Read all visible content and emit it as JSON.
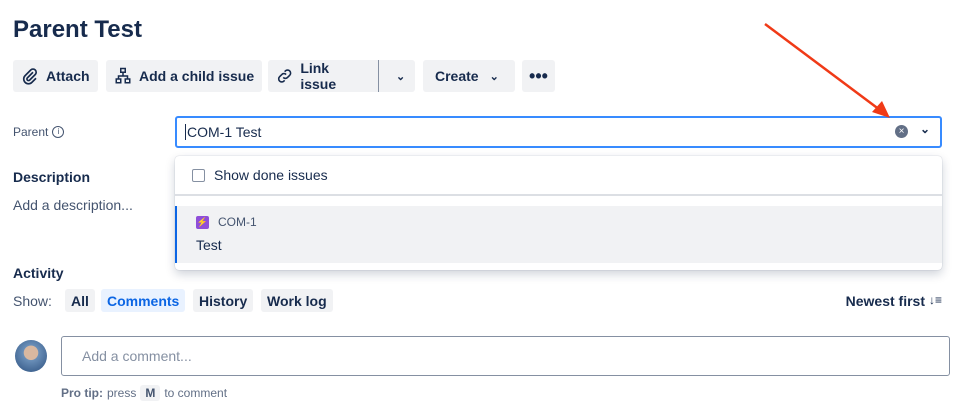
{
  "title": "Parent Test",
  "toolbar": {
    "attach": "Attach",
    "add_child": "Add a child issue",
    "link_issue": "Link issue",
    "create": "Create"
  },
  "parent": {
    "label": "Parent",
    "value": "COM-1 Test"
  },
  "dropdown": {
    "show_done": "Show done issues",
    "option": {
      "key": "COM-1",
      "summary": "Test"
    }
  },
  "description": {
    "label": "Description",
    "placeholder": "Add a description..."
  },
  "activity": {
    "label": "Activity",
    "show": "Show:",
    "tabs": [
      "All",
      "Comments",
      "History",
      "Work log"
    ],
    "active_tab": "Comments",
    "sort": "Newest first"
  },
  "comment": {
    "placeholder": "Add a comment...",
    "tip_bold": "Pro tip:",
    "tip_pre": "press",
    "tip_key": "M",
    "tip_post": "to comment"
  },
  "colors": {
    "accent": "#0c66e4",
    "annotation": "#f03a17",
    "epic": "#8f4ed9"
  }
}
